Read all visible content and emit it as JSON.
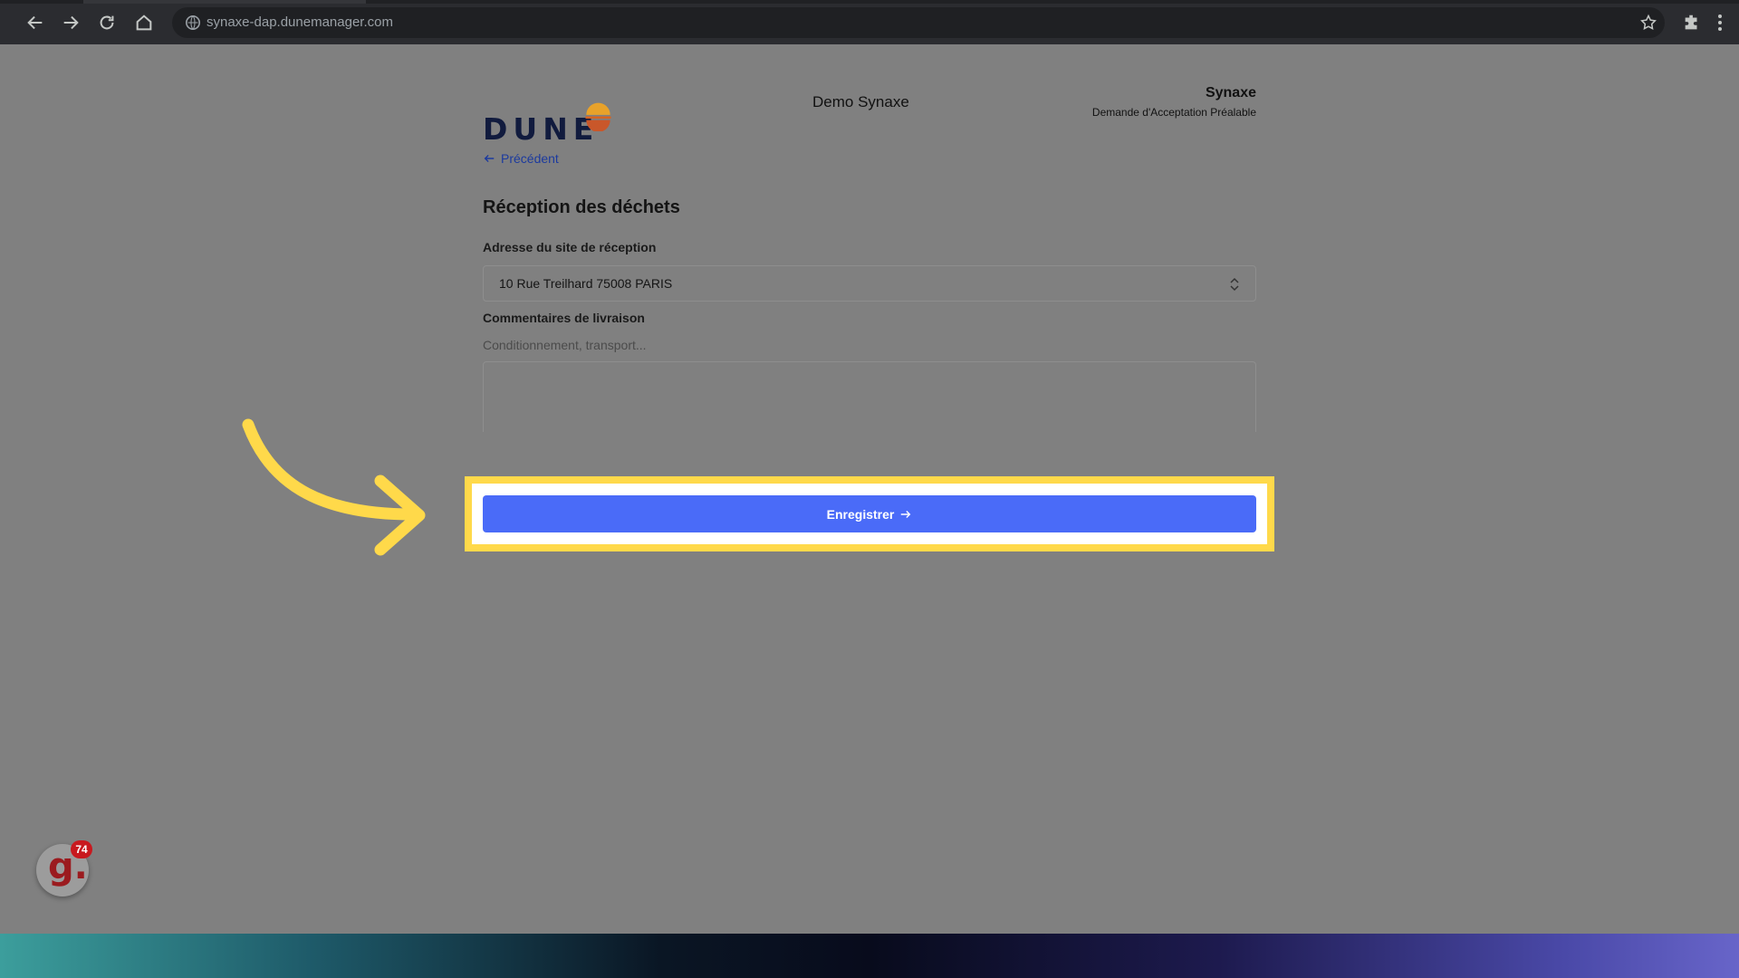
{
  "browser": {
    "url": "synaxe-dap.dunemanager.com",
    "icons": [
      "back-icon",
      "forward-icon",
      "reload-icon",
      "home-icon",
      "site-info-icon",
      "bookmark-star-icon",
      "extensions-icon",
      "menu-icon"
    ]
  },
  "header": {
    "logo_text": "DUNE",
    "client_name": "Demo Synaxe",
    "company": "Synaxe",
    "document_type": "Demande d'Acceptation Préalable"
  },
  "nav": {
    "back_label": "Précédent"
  },
  "form": {
    "title": "Réception des déchets",
    "address_label": "Adresse du site de réception",
    "address_value": "10 Rue Treilhard 75008 PARIS",
    "comments_label": "Commentaires de livraison",
    "comments_hint": "Conditionnement, transport...",
    "comments_value": "",
    "save_label": "Enregistrer"
  },
  "overlay": {
    "highlight_color": "#ffd94a",
    "arrow_color": "#ffd94a"
  },
  "badge": {
    "letter": "g.",
    "count": "74"
  },
  "colors": {
    "primary": "#4a6bf8",
    "link": "#1c3a9e"
  }
}
